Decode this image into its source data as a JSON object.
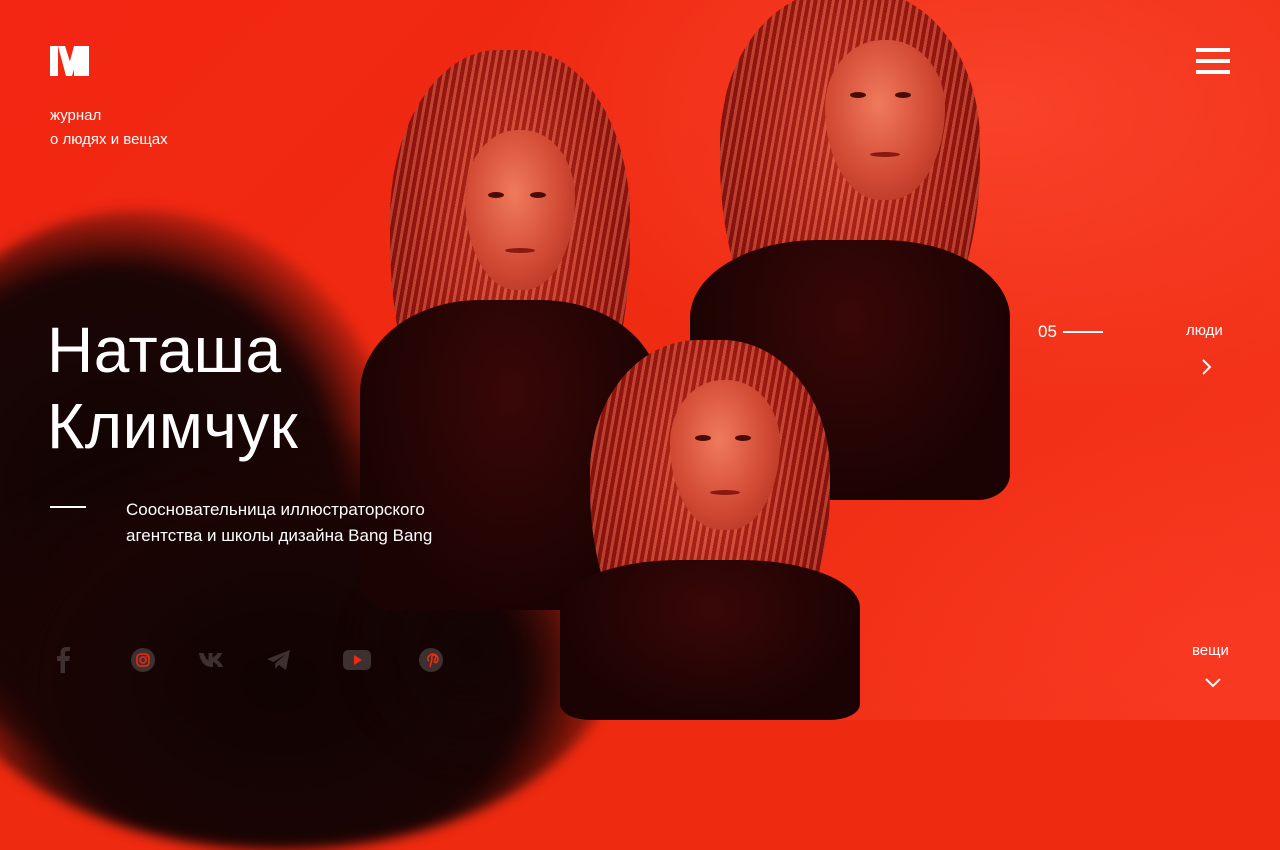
{
  "header": {
    "logo": "M",
    "tagline_line1": "журнал",
    "tagline_line2": "о людях и вещах",
    "menu_icon": "hamburger-menu-icon"
  },
  "hero": {
    "name_line1": "Наташа",
    "name_line2": "Климчук",
    "description_line1": "Сооснователь­ница иллюстраторского",
    "description_line2": "агентства и школы дизайна Bang Bang",
    "image": "triple-portrait-red-photo"
  },
  "pager": {
    "current": "05"
  },
  "nav": {
    "people_label": "люди",
    "people_icon": "chevron-right-icon",
    "things_label": "вещи",
    "things_icon": "chevron-down-icon"
  },
  "social": [
    "facebook-icon",
    "instagram-icon",
    "vk-icon",
    "telegram-icon",
    "youtube-icon",
    "pinterest-icon"
  ],
  "colors": {
    "background_red": "#ee2a10",
    "text": "#ffffff",
    "social_icon": "#3d3030"
  }
}
